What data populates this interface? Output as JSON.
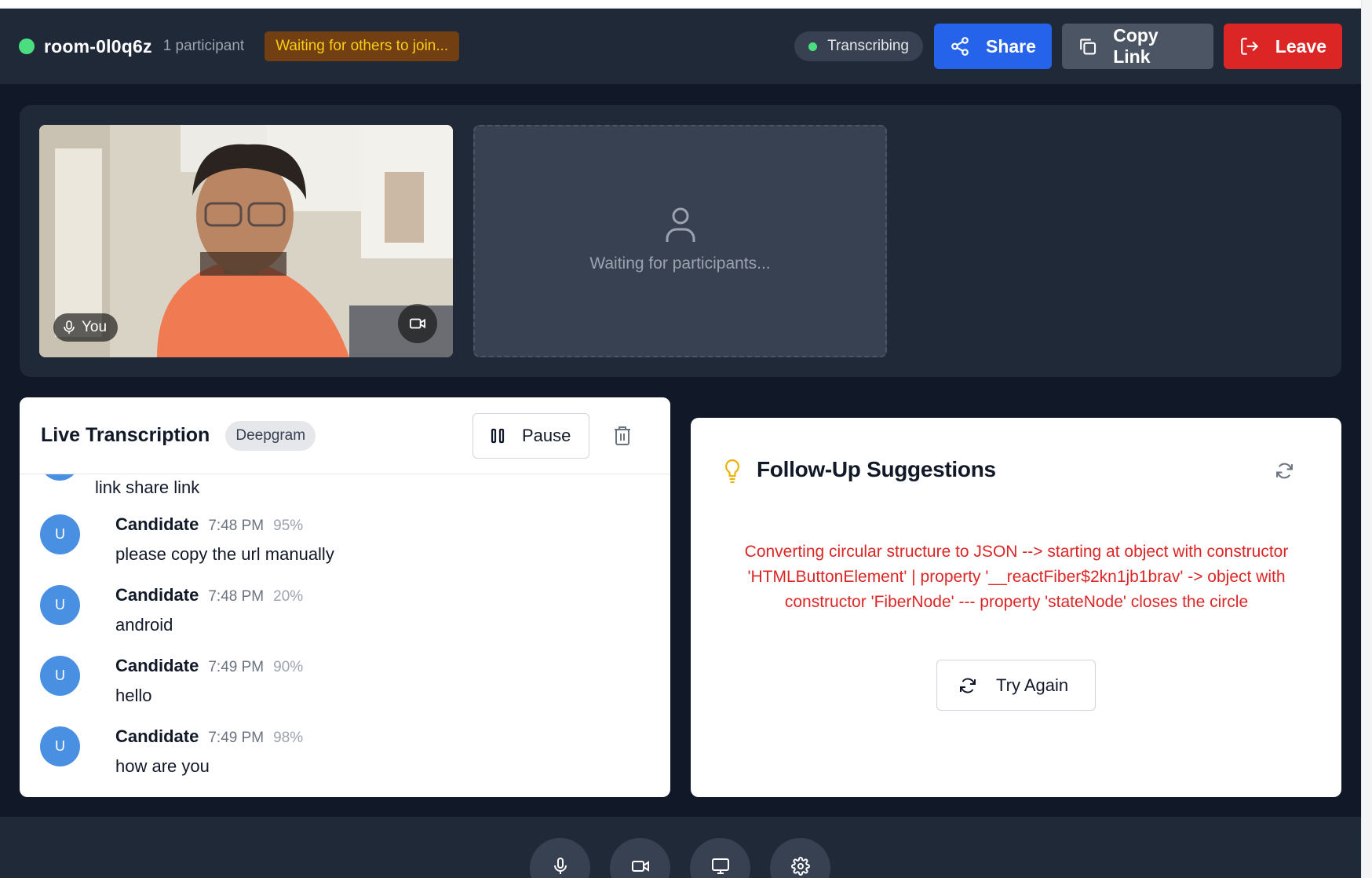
{
  "header": {
    "room_name": "room-0l0q6z",
    "participant_count": "1 participant",
    "waiting_label": "Waiting for others to join...",
    "transcribing_label": "Transcribing",
    "share_label": "Share",
    "copy_link_label": "Copy Link",
    "leave_label": "Leave"
  },
  "video": {
    "self_label": "You",
    "placeholder_text": "Waiting for participants..."
  },
  "transcription": {
    "title": "Live Transcription",
    "provider": "Deepgram",
    "pause_label": "Pause",
    "partial_text": "link share link",
    "entries": [
      {
        "avatar": "U",
        "speaker": "Candidate",
        "time": "7:48 PM",
        "confidence": "95%",
        "text": "please copy the url manually"
      },
      {
        "avatar": "U",
        "speaker": "Candidate",
        "time": "7:48 PM",
        "confidence": "20%",
        "text": "android"
      },
      {
        "avatar": "U",
        "speaker": "Candidate",
        "time": "7:49 PM",
        "confidence": "90%",
        "text": "hello"
      },
      {
        "avatar": "U",
        "speaker": "Candidate",
        "time": "7:49 PM",
        "confidence": "98%",
        "text": "how are you"
      }
    ]
  },
  "suggestions": {
    "title": "Follow-Up Suggestions",
    "error_text": "Converting circular structure to JSON --> starting at object with constructor 'HTMLButtonElement' | property '__reactFiber$2kn1jb1brav' -> object with constructor 'FiberNode' --- property 'stateNode' closes the circle",
    "retry_label": "Try Again"
  },
  "colors": {
    "status_green": "#4ade80",
    "share_blue": "#2563eb",
    "leave_red": "#dc2626",
    "error_red": "#dc2626",
    "bulb_yellow": "#eab308"
  },
  "icons": {
    "controls": [
      "microphone-icon",
      "camera-icon",
      "monitor-icon",
      "settings-gear-icon"
    ]
  }
}
